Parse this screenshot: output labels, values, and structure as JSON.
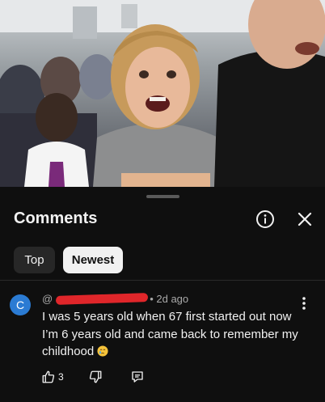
{
  "sheet": {
    "title": "Comments",
    "icons": {
      "info": "info-circle-icon",
      "close": "close-icon"
    },
    "chips": [
      {
        "label": "Top",
        "selected": false
      },
      {
        "label": "Newest",
        "selected": true
      }
    ]
  },
  "comment": {
    "avatar_letter": "C",
    "avatar_color": "#2b7bd3",
    "username_redacted": true,
    "time": "• 2d ago",
    "text": "I was 5 years old when 67 first started out now I’m 6 years old and came back to remember my childhood",
    "emoji": "crying-face-emoji",
    "likes": "3",
    "icons": {
      "like": "thumbs-up-icon",
      "dislike": "thumbs-down-icon",
      "reply": "reply-icon",
      "menu": "more-vert-icon"
    }
  },
  "colors": {
    "background": "#0f0f0f",
    "redaction": "#e0262a",
    "chip_selected": "#f1f1f1",
    "chip": "#272727"
  }
}
